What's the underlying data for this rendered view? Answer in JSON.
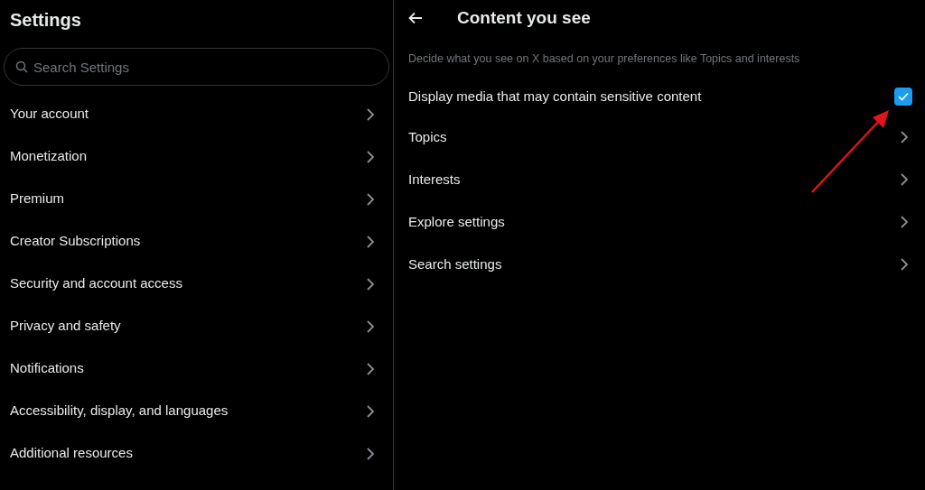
{
  "sidebar": {
    "title": "Settings",
    "search": {
      "placeholder": "Search Settings"
    },
    "items": [
      {
        "label": "Your account"
      },
      {
        "label": "Monetization"
      },
      {
        "label": "Premium"
      },
      {
        "label": "Creator Subscriptions"
      },
      {
        "label": "Security and account access"
      },
      {
        "label": "Privacy and safety"
      },
      {
        "label": "Notifications"
      },
      {
        "label": "Accessibility, display, and languages"
      },
      {
        "label": "Additional resources"
      }
    ]
  },
  "panel": {
    "title": "Content you see",
    "description": "Decide what you see on X based on your preferences like Topics and interests",
    "items": [
      {
        "kind": "checkbox",
        "label": "Display media that may contain sensitive content",
        "checked": true
      },
      {
        "kind": "link",
        "label": "Topics"
      },
      {
        "kind": "link",
        "label": "Interests"
      },
      {
        "kind": "link",
        "label": "Explore settings"
      },
      {
        "kind": "link",
        "label": "Search settings"
      }
    ]
  }
}
